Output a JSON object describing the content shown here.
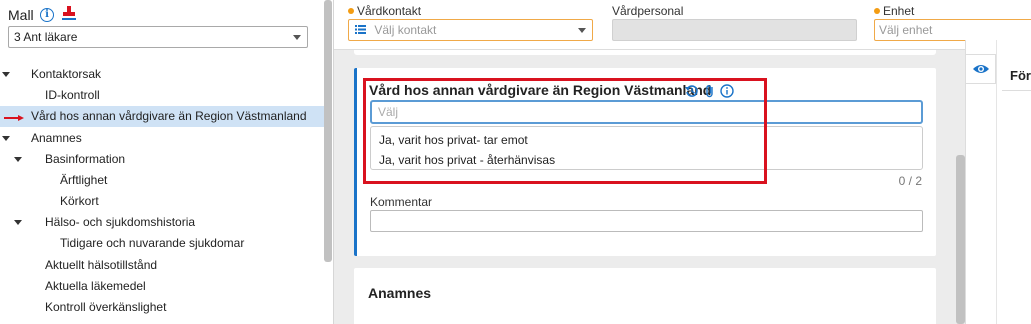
{
  "template": {
    "title": "Mall",
    "selected": "3 Ant läkare"
  },
  "tree": [
    {
      "label": "Kontaktorsak"
    },
    {
      "label": "ID-kontroll"
    },
    {
      "label": "Vård hos annan vårdgivare än Region Västmanland"
    },
    {
      "label": "Anamnes"
    },
    {
      "label": "Basinformation"
    },
    {
      "label": "Ärftlighet"
    },
    {
      "label": "Körkort"
    },
    {
      "label": "Hälso- och sjukdomshistoria"
    },
    {
      "label": "Tidigare och nuvarande sjukdomar"
    },
    {
      "label": "Aktuellt hälsotillstånd"
    },
    {
      "label": "Aktuella läkemedel"
    },
    {
      "label": "Kontroll överkänslighet"
    }
  ],
  "header": {
    "vardkontakt_label": "Vårdkontakt",
    "vardkontakt_placeholder": "Välj kontakt",
    "vardpersonal_label": "Vårdpersonal",
    "enhet_label": "Enhet",
    "enhet_placeholder": "Välj enhet"
  },
  "section": {
    "title": "Vård hos annan vårdgivare än Region Västmanland",
    "input_placeholder": "Välj",
    "options": [
      "Ja, varit hos privat- tar emot",
      "Ja, varit hos privat - återhänvisas"
    ],
    "counter": "0 / 2",
    "comment_label": "Kommentar"
  },
  "section2": {
    "title": "Anamnes"
  },
  "right_panel": {
    "title": "Förh"
  },
  "colors": {
    "accent": "#1a73c8",
    "selection": "#cfe2f5",
    "highlight_red": "#d9121f",
    "required_dot": "#f39c12"
  }
}
